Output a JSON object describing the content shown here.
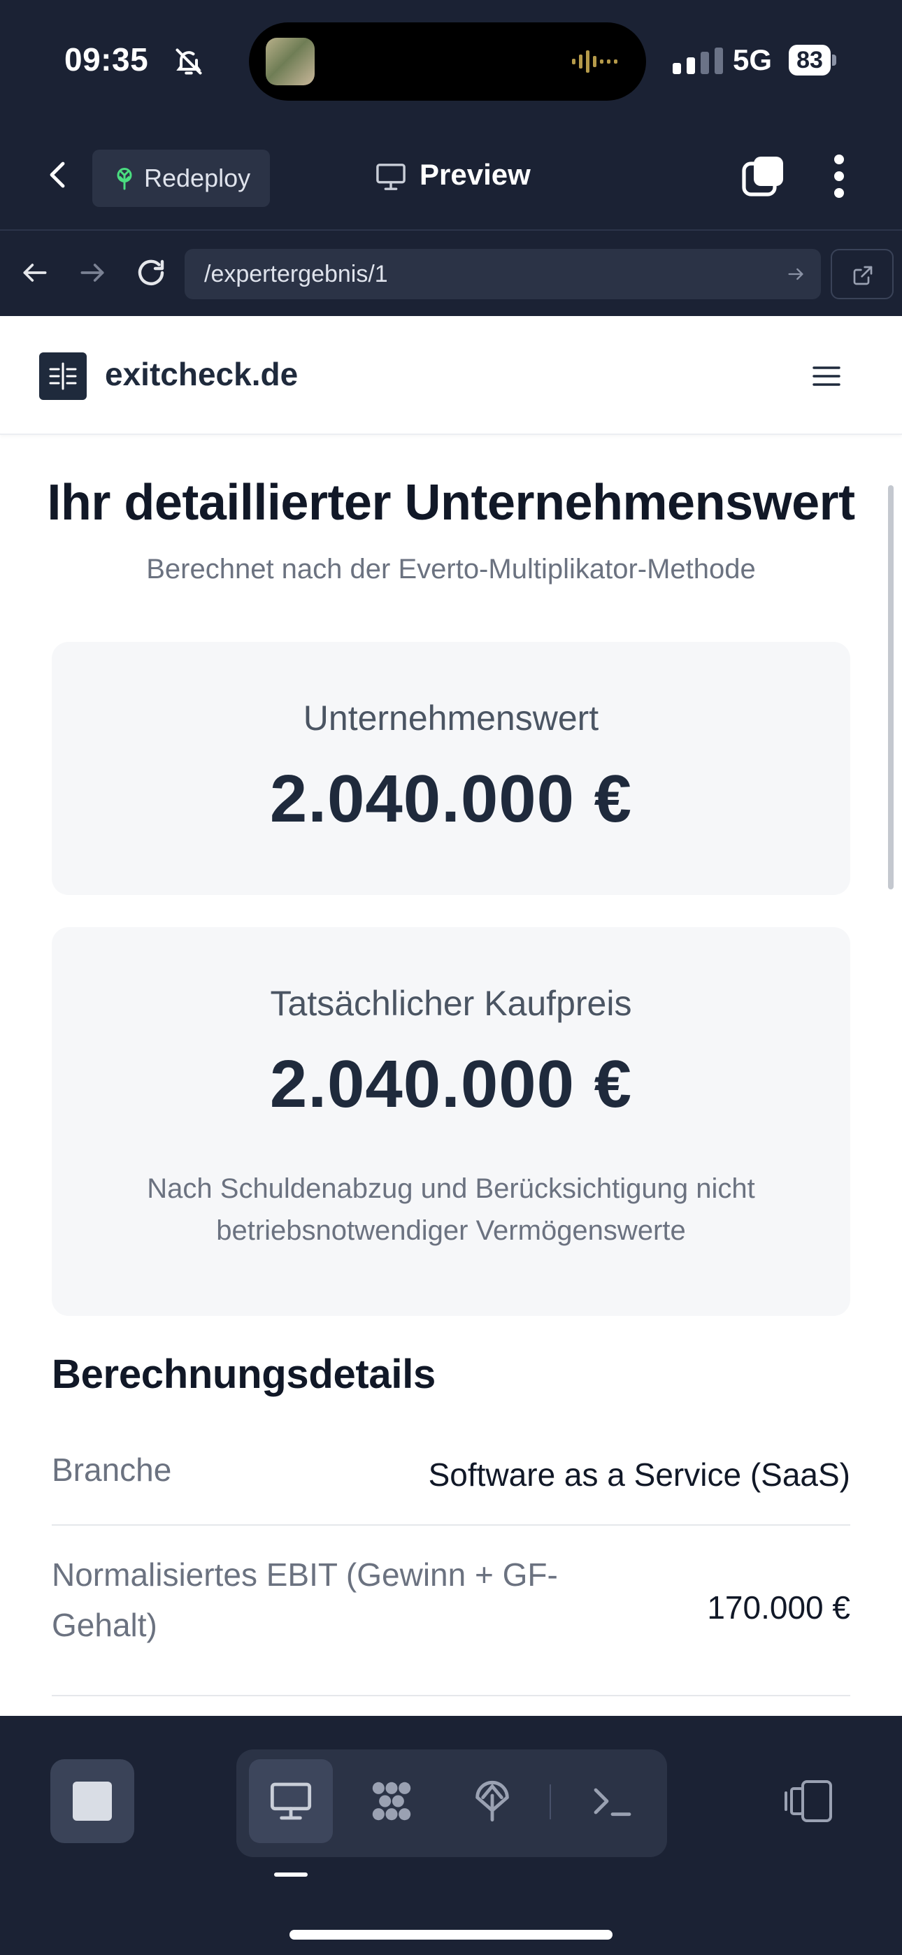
{
  "status_bar": {
    "time": "09:35",
    "network": "5G",
    "battery": "83"
  },
  "app_toolbar": {
    "redeploy_label": "Redeploy",
    "preview_label": "Preview"
  },
  "browser": {
    "url": "/expertergebnis/1"
  },
  "site": {
    "name": "exitcheck.de"
  },
  "page": {
    "title": "Ihr detaillierter Unternehmenswert",
    "subtitle": "Berechnet nach der Everto-Multiplikator-Methode"
  },
  "cards": {
    "company_value": {
      "label": "Unternehmenswert",
      "value": "2.040.000 €"
    },
    "purchase_price": {
      "label": "Tatsächlicher Kaufpreis",
      "value": "2.040.000 €",
      "note": "Nach Schuldenabzug und Berücksichtigung nicht betriebsnotwendiger Vermögenswerte"
    }
  },
  "details": {
    "title": "Berechnungsdetails",
    "rows": [
      {
        "label": "Branche",
        "value": "Software as a Service (SaaS)"
      },
      {
        "label": "Normalisiertes EBIT (Gewinn + GF-Gehalt)",
        "value": "170.000 €"
      }
    ]
  },
  "icons": {
    "status": [
      "bell-muted-icon",
      "audio-wave-icon",
      "signal-icon"
    ],
    "toolbar": [
      "back-chevron-icon",
      "sprout-icon",
      "monitor-icon",
      "tabs-icon",
      "kebab-menu-icon"
    ],
    "browser": [
      "arrow-left-icon",
      "arrow-right-icon",
      "reload-icon",
      "go-arrow-icon",
      "external-link-icon"
    ],
    "site": [
      "site-logo-icon",
      "hamburger-icon"
    ],
    "dock": [
      "stop-icon",
      "monitor-icon",
      "apps-grid-icon",
      "antenna-icon",
      "terminal-icon",
      "device-toggle-icon"
    ]
  },
  "colors": {
    "chrome_bg": "#1b2234",
    "field_bg": "#2b3346",
    "accent_dark": "#1f2a3c",
    "card_bg": "#f6f7f9",
    "redeploy_icon": "#4ade80"
  }
}
